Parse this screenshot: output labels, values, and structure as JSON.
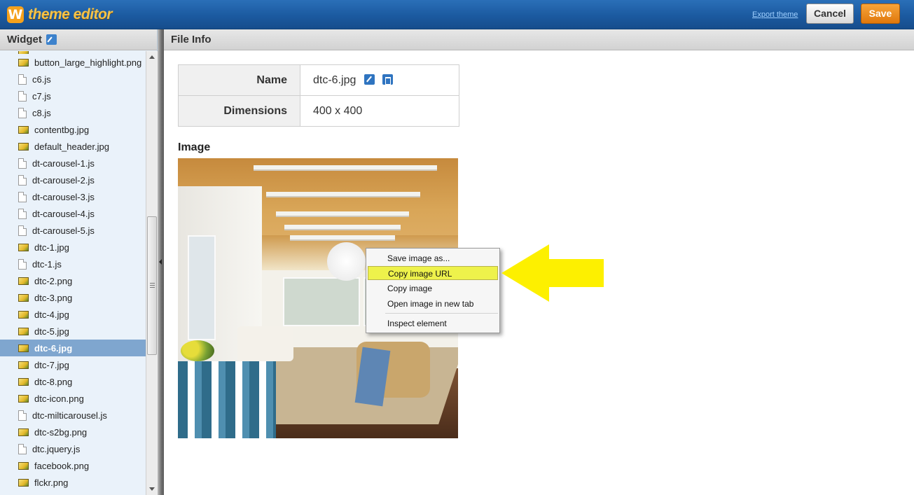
{
  "app": {
    "logo_letter": "W",
    "title": "theme editor",
    "export_link": "Export theme",
    "cancel_label": "Cancel",
    "save_label": "Save"
  },
  "sidebar": {
    "title": "Widget",
    "files": [
      {
        "name": "",
        "type": "image",
        "partial": true
      },
      {
        "name": "button_large_highlight.png",
        "type": "image"
      },
      {
        "name": "c6.js",
        "type": "doc"
      },
      {
        "name": "c7.js",
        "type": "doc"
      },
      {
        "name": "c8.js",
        "type": "doc"
      },
      {
        "name": "contentbg.jpg",
        "type": "image"
      },
      {
        "name": "default_header.jpg",
        "type": "image"
      },
      {
        "name": "dt-carousel-1.js",
        "type": "doc"
      },
      {
        "name": "dt-carousel-2.js",
        "type": "doc"
      },
      {
        "name": "dt-carousel-3.js",
        "type": "doc"
      },
      {
        "name": "dt-carousel-4.js",
        "type": "doc"
      },
      {
        "name": "dt-carousel-5.js",
        "type": "doc"
      },
      {
        "name": "dtc-1.jpg",
        "type": "image"
      },
      {
        "name": "dtc-1.js",
        "type": "doc"
      },
      {
        "name": "dtc-2.png",
        "type": "image"
      },
      {
        "name": "dtc-3.png",
        "type": "image"
      },
      {
        "name": "dtc-4.jpg",
        "type": "image"
      },
      {
        "name": "dtc-5.jpg",
        "type": "image"
      },
      {
        "name": "dtc-6.jpg",
        "type": "image",
        "selected": true
      },
      {
        "name": "dtc-7.jpg",
        "type": "image"
      },
      {
        "name": "dtc-8.png",
        "type": "image"
      },
      {
        "name": "dtc-icon.png",
        "type": "image"
      },
      {
        "name": "dtc-milticarousel.js",
        "type": "doc"
      },
      {
        "name": "dtc-s2bg.png",
        "type": "image"
      },
      {
        "name": "dtc.jquery.js",
        "type": "doc"
      },
      {
        "name": "facebook.png",
        "type": "image"
      },
      {
        "name": "flckr.png",
        "type": "image"
      }
    ]
  },
  "main": {
    "title": "File Info",
    "name_label": "Name",
    "name_value": "dtc-6.jpg",
    "dimensions_label": "Dimensions",
    "dimensions_value": "400 x 400",
    "image_label": "Image"
  },
  "context_menu": {
    "items": [
      {
        "label": "Save image as...",
        "highlighted": false
      },
      {
        "label": "Copy image URL",
        "highlighted": true
      },
      {
        "label": "Copy image",
        "highlighted": false
      },
      {
        "label": "Open image in new tab",
        "highlighted": false
      },
      {
        "label": "Inspect element",
        "highlighted": false
      }
    ]
  },
  "colors": {
    "topbar": "#1b5aa0",
    "accent_orange": "#e0780c",
    "selected_row": "#7fa6cf",
    "arrow": "#fdf000",
    "menu_highlight": "#eef24b"
  },
  "icons": {
    "edit": "pencil-icon",
    "delete": "trash-icon",
    "image_file": "image-file-icon",
    "doc_file": "doc-file-icon"
  }
}
